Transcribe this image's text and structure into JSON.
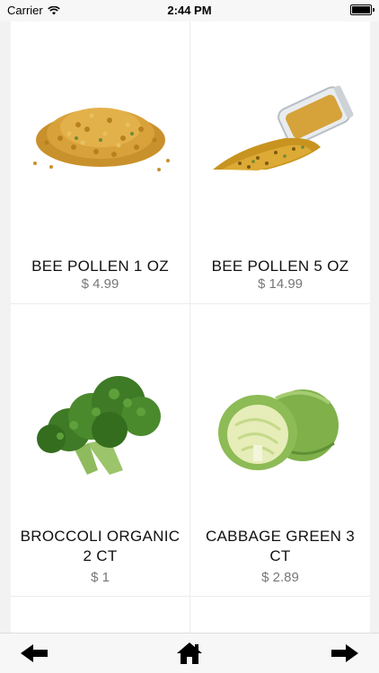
{
  "status_bar": {
    "carrier": "Carrier",
    "time": "2:44 PM"
  },
  "products": [
    {
      "name": "BEE POLLEN 1 OZ",
      "price": "$ 4.99",
      "image": "bee-pollen-pile"
    },
    {
      "name": "BEE POLLEN 5 OZ",
      "price": "$ 14.99",
      "image": "bee-pollen-jar"
    },
    {
      "name": "BROCCOLI ORGANIC 2 CT",
      "price": "$ 1",
      "image": "broccoli"
    },
    {
      "name": "CABBAGE GREEN 3 CT",
      "price": "$ 2.89",
      "image": "cabbage"
    }
  ],
  "bottom_nav": {
    "back_icon": "arrow-left-icon",
    "home_icon": "home-icon",
    "forward_icon": "arrow-right-icon"
  },
  "colors": {
    "title": "#111111",
    "price": "#777777",
    "divider": "#ececec",
    "background": "#f2f2f2"
  }
}
